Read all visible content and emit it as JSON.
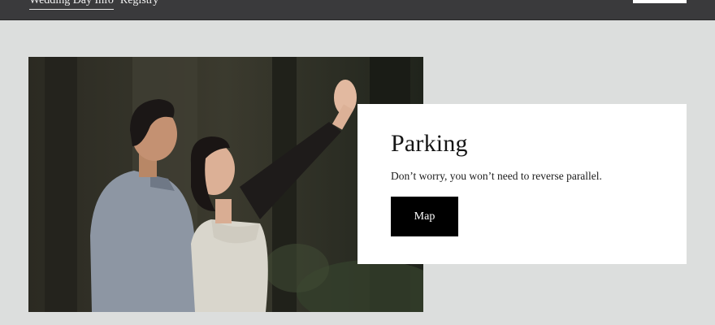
{
  "header": {
    "nav": [
      {
        "label": "Wedding Day Info",
        "active": true
      },
      {
        "label": "Registry",
        "active": false
      }
    ]
  },
  "parking": {
    "title": "Parking",
    "description": "Don’t worry, you won’t need to reverse parallel.",
    "button_label": "Map"
  },
  "colors": {
    "page_background": "#dcdedd",
    "header_background": "#3a3a3c",
    "card_background": "#ffffff",
    "button_background": "#000000"
  }
}
